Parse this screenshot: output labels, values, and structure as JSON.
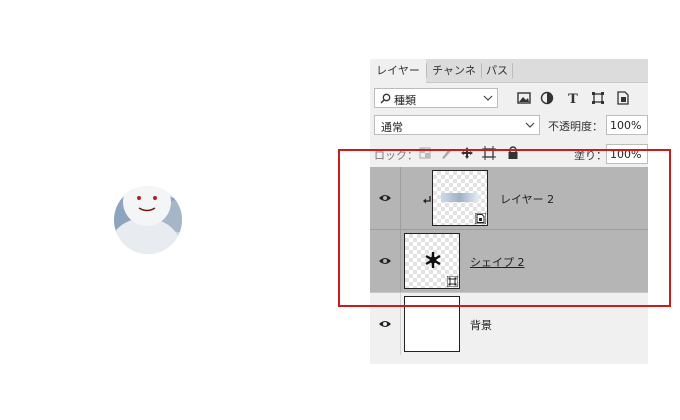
{
  "panel": {
    "tabs": [
      {
        "label": "レイヤー",
        "active": true
      },
      {
        "label": "チャンネル",
        "active": false
      },
      {
        "label": "パス",
        "active": false
      }
    ],
    "filter": {
      "label": "種類"
    },
    "blend_mode": "通常",
    "opacity": {
      "label": "不透明度：",
      "value": "100%"
    },
    "lock": {
      "label": "ロック："
    },
    "fill": {
      "label": "塗り：",
      "value": "100%"
    },
    "layers": [
      {
        "name": "レイヤー 2",
        "selected": true,
        "clipped": true,
        "type": "smart-object"
      },
      {
        "name": "シェイプ 2",
        "selected": true,
        "clipped": false,
        "type": "shape"
      },
      {
        "name": "背景",
        "selected": false,
        "clipped": false,
        "type": "background"
      }
    ]
  },
  "colors": {
    "panel_bg": "#f0f0f0",
    "selected_row": "#b5b5b5",
    "highlight_border": "#c91c1c"
  }
}
